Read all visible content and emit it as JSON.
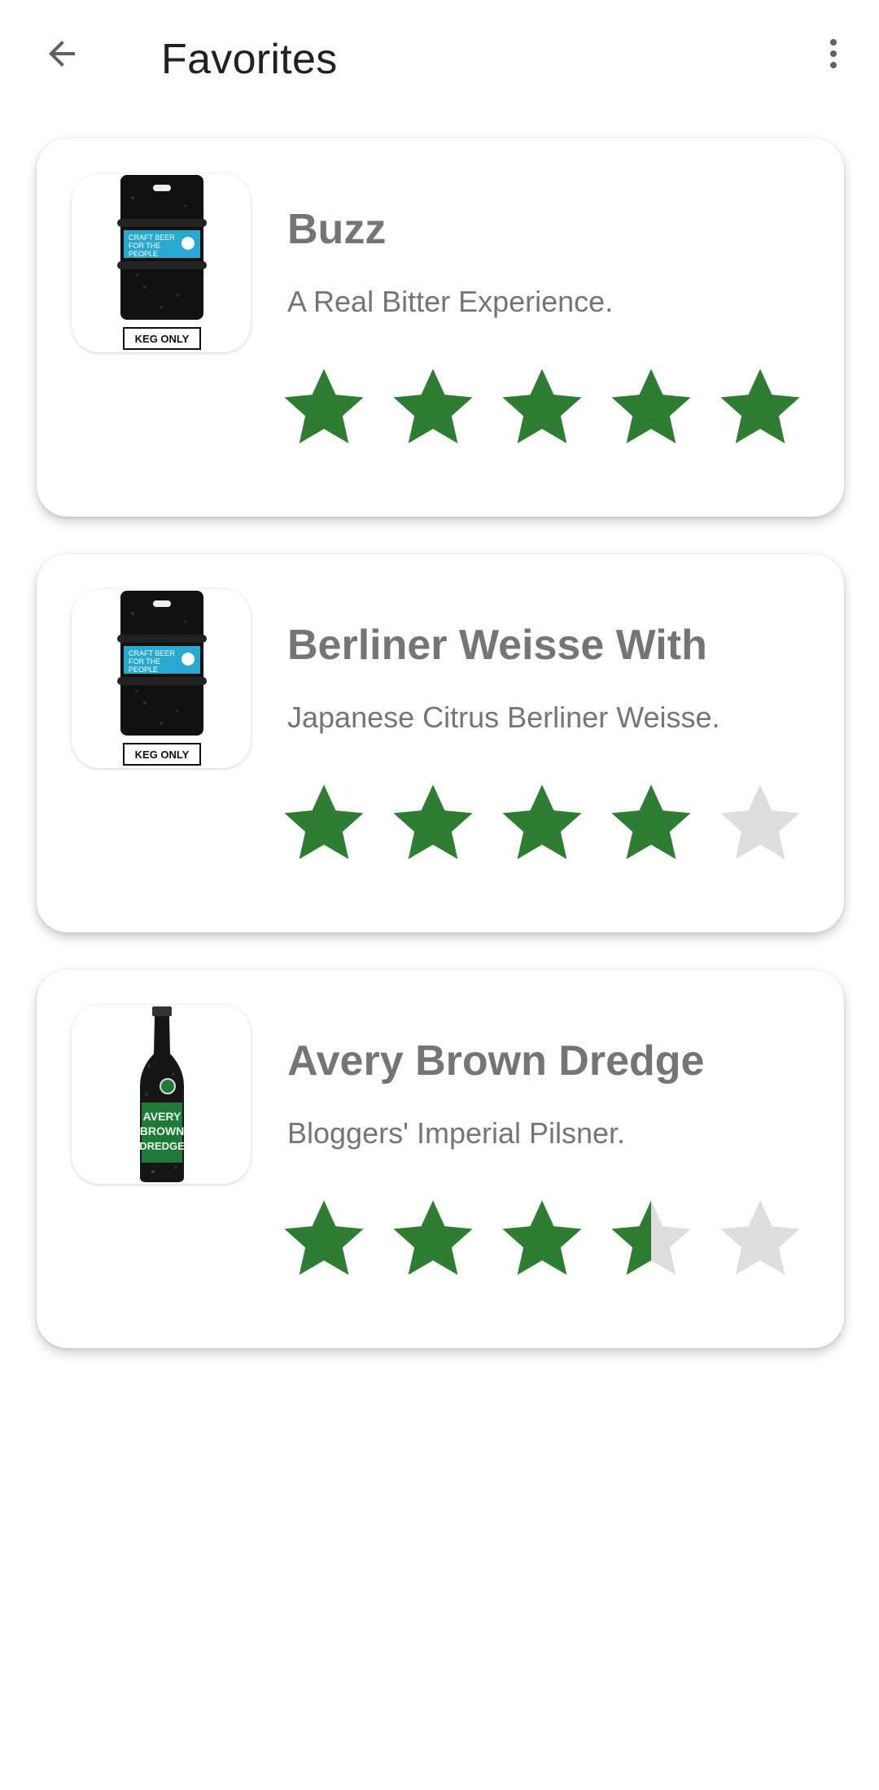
{
  "appbar": {
    "title": "Favorites",
    "back_icon": "arrow-back-icon",
    "more_icon": "more-vert-icon"
  },
  "colors": {
    "star_filled": "#2e7d32",
    "star_empty": "#dddddd",
    "text_secondary": "#757575"
  },
  "favorites": [
    {
      "name": "Buzz",
      "tagline": "A Real Bitter Experience.",
      "rating": 5,
      "image": "keg-image",
      "image_label": "KEG ONLY"
    },
    {
      "name": "Berliner Weisse With",
      "tagline": "Japanese Citrus Berliner Weisse.",
      "rating": 4,
      "image": "keg-image",
      "image_label": "KEG ONLY"
    },
    {
      "name": "Avery Brown Dredge",
      "tagline": "Bloggers' Imperial Pilsner.",
      "rating": 3.5,
      "image": "bottle-image",
      "image_label": "AVERY BROWN DREDGE"
    }
  ],
  "rating_max": 5
}
